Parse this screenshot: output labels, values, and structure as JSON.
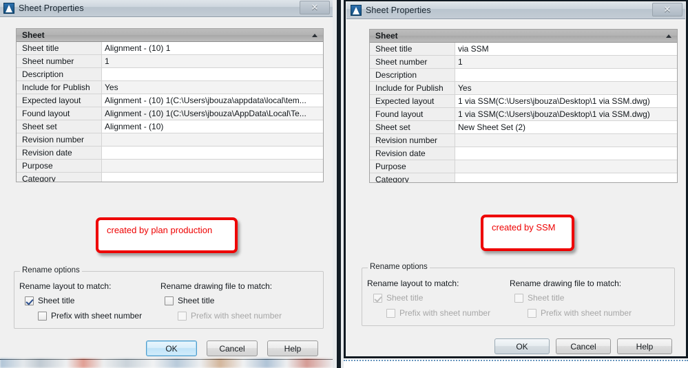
{
  "left_dialog": {
    "title": "Sheet Properties",
    "app_icon": "autocad-a-icon",
    "close_label": "✕",
    "grid": {
      "header": "Sheet",
      "collapse_icon": "chevron-up-icon",
      "rows": [
        {
          "name": "Sheet title",
          "value": "Alignment - (10) 1"
        },
        {
          "name": "Sheet number",
          "value": "1"
        },
        {
          "name": "Description",
          "value": ""
        },
        {
          "name": "Include for Publish",
          "value": "Yes"
        },
        {
          "name": "Expected layout",
          "value": "Alignment - (10) 1(C:\\Users\\jbouza\\appdata\\local\\tem..."
        },
        {
          "name": "Found layout",
          "value": "Alignment - (10) 1(C:\\Users\\jbouza\\AppData\\Local\\Te..."
        },
        {
          "name": "Sheet set",
          "value": "Alignment - (10)"
        },
        {
          "name": "Revision number",
          "value": ""
        },
        {
          "name": "Revision date",
          "value": ""
        },
        {
          "name": "Purpose",
          "value": ""
        },
        {
          "name": "Category",
          "value": ""
        }
      ]
    },
    "callout": {
      "text": "created by plan production",
      "color": "#ee0000"
    },
    "rename_options": {
      "legend": "Rename options",
      "layout_label": "Rename layout to match:",
      "drawing_label": "Rename drawing file to match:",
      "layout_sheet_title": "Sheet title",
      "layout_prefix": "Prefix with sheet number",
      "drawing_sheet_title": "Sheet title",
      "drawing_prefix": "Prefix with sheet number"
    },
    "buttons": {
      "ok": "OK",
      "cancel": "Cancel",
      "help": "Help"
    }
  },
  "right_dialog": {
    "title": "Sheet Properties",
    "app_icon": "autocad-a-icon",
    "close_label": "✕",
    "grid": {
      "header": "Sheet",
      "collapse_icon": "chevron-up-icon",
      "rows": [
        {
          "name": "Sheet title",
          "value": "via SSM"
        },
        {
          "name": "Sheet number",
          "value": "1"
        },
        {
          "name": "Description",
          "value": ""
        },
        {
          "name": "Include for Publish",
          "value": "Yes"
        },
        {
          "name": "Expected layout",
          "value": "1 via SSM(C:\\Users\\jbouza\\Desktop\\1 via SSM.dwg)"
        },
        {
          "name": "Found layout",
          "value": "1 via SSM(C:\\Users\\jbouza\\Desktop\\1 via SSM.dwg)"
        },
        {
          "name": "Sheet set",
          "value": "New Sheet Set (2)"
        },
        {
          "name": "Revision number",
          "value": ""
        },
        {
          "name": "Revision date",
          "value": ""
        },
        {
          "name": "Purpose",
          "value": ""
        },
        {
          "name": "Category",
          "value": ""
        }
      ]
    },
    "callout": {
      "text": "created by SSM",
      "color": "#ee0000"
    },
    "rename_options": {
      "legend": "Rename options",
      "layout_label": "Rename layout to match:",
      "drawing_label": "Rename drawing file to match:",
      "layout_sheet_title": "Sheet title",
      "layout_prefix": "Prefix with sheet number",
      "drawing_sheet_title": "Sheet title",
      "drawing_prefix": "Prefix with sheet number"
    },
    "buttons": {
      "ok": "OK",
      "cancel": "Cancel",
      "help": "Help"
    }
  }
}
